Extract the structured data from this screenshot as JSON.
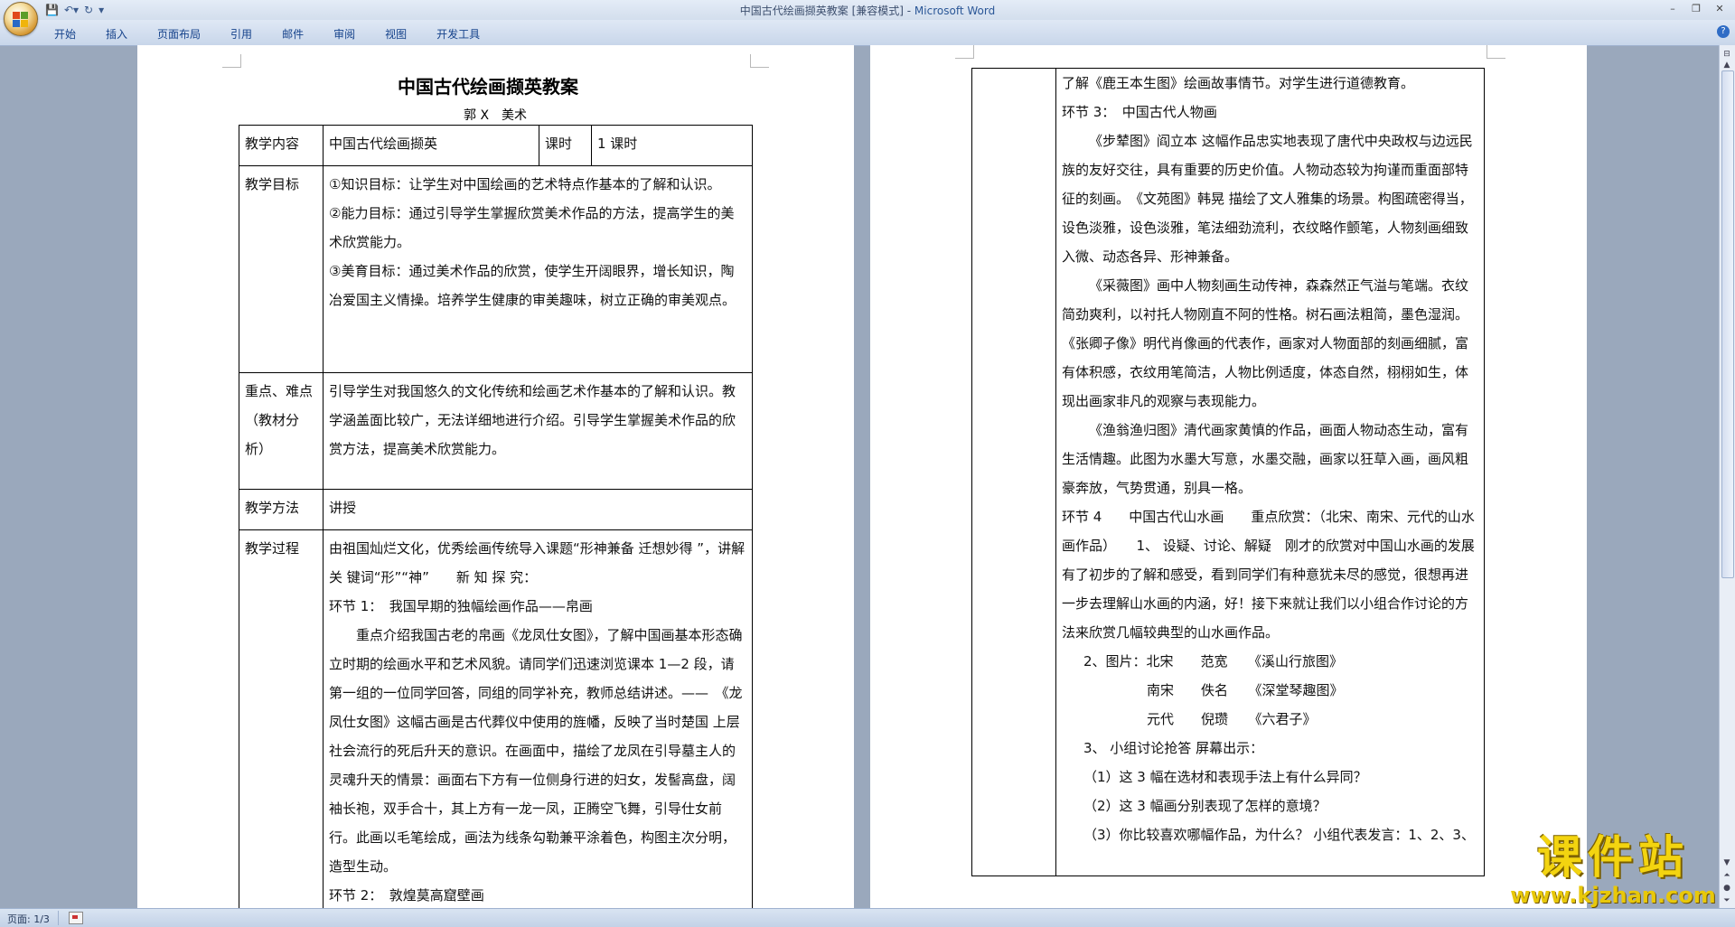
{
  "window": {
    "title": "中国古代绘画撷英教案 [兼容模式] - ",
    "app_name": "Microsoft Word"
  },
  "ribbon": {
    "tabs": [
      "开始",
      "插入",
      "页面布局",
      "引用",
      "邮件",
      "审阅",
      "视图",
      "开发工具"
    ]
  },
  "status": {
    "page": "页面: 1/3"
  },
  "doc": {
    "title": "中国古代绘画撷英教案",
    "author": "郭 X　美术",
    "row1": {
      "label": "教学内容",
      "value": "中国古代绘画撷英",
      "label2": "课时",
      "value2": "1 课时"
    },
    "row2": {
      "label": "教学目标",
      "lines": [
        "①知识目标：让学生对中国绘画的艺术特点作基本的了解和认识。",
        "②能力目标：通过引导学生掌握欣赏美术作品的方法，提高学生的美术欣赏能力。",
        "③美育目标：通过美术作品的欣赏，使学生开阔眼界，增长知识，陶冶爱国主义情操。培养学生健康的审美趣味，树立正确的审美观点。"
      ]
    },
    "row3": {
      "label": "重点、难点（教材分析）",
      "text": "引导学生对我国悠久的文化传统和绘画艺术作基本的了解和认识。教学涵盖面比较广，无法详细地进行介绍。引导学生掌握美术作品的欣赏方法，提高美术欣赏能力。"
    },
    "row4": {
      "label": "教学方法",
      "value": "讲授"
    },
    "row5": {
      "label": "教学过程",
      "lines": [
        "由祖国灿烂文化，优秀绘画传统导入课题“形神兼备 迁想妙得 ”，讲解关 键词“形”“神”　　新 知 探 究：",
        "环节 1：　我国早期的独幅绘画作品——帛画",
        "重点介绍我国古老的帛画《龙凤仕女图》，了解中国画基本形态确立时期的绘画水平和艺术风貌。请同学们迅速浏览课本 1—2 段，请第一组的一位同学回答，同组的同学补充，教师总结讲述。——　《龙凤仕女图》这幅古画是古代葬仪中使用的旌幡，反映了当时楚国 上层社会流行的死后升天的意识。在画面中，描绘了龙凤在引导墓主人的灵魂升天的情景：画面右下方有一位侧身行进的妇女，发髻高盘，阔袖长袍，双手合十，其上方有一龙一凤，正腾空飞舞，引导仕女前行。此画以毛笔绘成，画法为线条勾勒兼平涂着色，构图主次分明，造型生动。",
        "环节 2：　敦煌莫高窟壁画"
      ]
    },
    "page2": {
      "lines": [
        "了解《鹿王本生图》绘画故事情节。对学生进行道德教育。",
        "环节 3：　中国古代人物画",
        "《步辇图》阎立本 这幅作品忠实地表现了唐代中央政权与边远民族的友好交往，具有重要的历史价值。人物动态较为拘谨而重面部特征的刻画。　《文苑图》韩晃 描绘了文人雅集的场景。构图疏密得当，设色淡雅，设色淡雅，笔法细劲流利，衣纹略作颤笔，人物刻画细致入微、动态各异、形神兼备。",
        "《采薇图》画中人物刻画生动传神，森森然正气溢与笔端。衣纹简劲爽利，以衬托人物刚直不阿的性格。树石画法粗简，墨色湿润。　《张卿子像》明代肖像画的代表作，画家对人物面部的刻画细腻，富有体积感，衣纹用笔简洁，人物比例适度，体态自然，栩栩如生，体现出画家非凡的观察与表现能力。",
        "《渔翁渔归图》清代画家黄慎的作品，画面人物动态生动，富有生活情趣。此图为水墨大写意，水墨交融，画家以狂草入画，画风粗豪奔放，气势贯通，别具一格。",
        "环节 4　　中国古代山水画　　重点欣赏：（北宋、南宋、元代的山水画作品）　　1、 设疑、讨论、解疑　刚才的欣赏对中国山水画的发展有了初步的了解和感受，看到同学们有种意犹未尽的感觉，很想再进一步去理解山水画的内涵，好！接下来就让我们以小组合作讨论的方法来欣赏几幅较典型的山水画作品。",
        "2、图片：北宋　　范宽　　《溪山行旅图》",
        "南宋　　佚名　　《深堂琴趣图》",
        "元代　　倪瓒　　《六君子》",
        "3、 小组讨论抢答 屏幕出示：",
        "（1）这 3 幅在选材和表现手法上有什么异同？",
        "（2）这 3 幅画分别表现了怎样的意境？",
        "（3）你比较喜欢哪幅作品，为什么？ 小组代表发言：1、2、3、"
      ]
    }
  },
  "watermark": {
    "cn": "课件站",
    "url": "www.kjzhan.com"
  }
}
